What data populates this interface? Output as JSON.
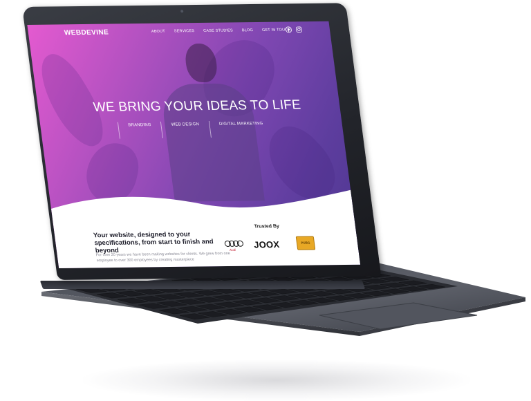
{
  "site": {
    "logo": "WEBDEVINE",
    "nav": [
      "ABOUT",
      "SERVICES",
      "CASE STUDIES",
      "BLOG",
      "GET IN TOUCH"
    ],
    "social_icons": [
      "facebook-icon",
      "instagram-icon"
    ]
  },
  "hero": {
    "title": "WE BRING YOUR IDEAS TO LIFE",
    "services": [
      "BRANDING",
      "WEB DESIGN",
      "DIGITAL MARKETING"
    ]
  },
  "content": {
    "tagline": "Your website, designed to your specifications, from start to finish and beyond",
    "intro": "For over 20 years we have been making websites for clients. We grew from one employee to over 300 employees by creating masterpiece"
  },
  "trusted": {
    "heading": "Trusted By",
    "brands": [
      "Audi",
      "JOOX",
      "PUBG"
    ]
  },
  "colors": {
    "gradient_start": "#e45ad0",
    "gradient_end": "#4e3790",
    "device": "#22242a"
  }
}
